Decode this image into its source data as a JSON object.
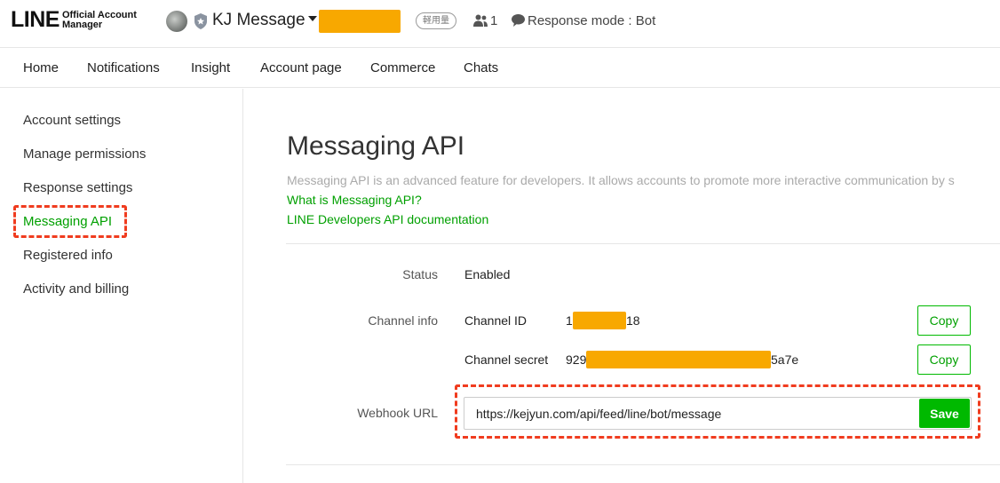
{
  "header": {
    "logo_main": "LINE",
    "logo_sub_line1": "Official Account",
    "logo_sub_line2": "Manager",
    "account_name": "KJ Message",
    "plan_badge": "軽用量",
    "follower_count": "1",
    "response_mode": "Response mode : Bot",
    "icons": [
      "avatar",
      "shield-icon",
      "caret-down-icon",
      "people-icon",
      "chat-bubble-icon"
    ]
  },
  "nav": {
    "items": [
      "Home",
      "Notifications",
      "Insight",
      "Account page",
      "Commerce",
      "Chats"
    ]
  },
  "sidebar": {
    "items": [
      {
        "label": "Account settings"
      },
      {
        "label": "Manage permissions"
      },
      {
        "label": "Response settings"
      },
      {
        "label": "Messaging API",
        "active": true
      },
      {
        "label": "Registered info"
      },
      {
        "label": "Activity and billing"
      }
    ]
  },
  "main": {
    "title": "Messaging API",
    "description": "Messaging API is an advanced feature for developers. It allows accounts to promote more interactive communication by s",
    "links": [
      "What is Messaging API?",
      "LINE Developers API documentation"
    ],
    "status": {
      "label": "Status",
      "value": "Enabled"
    },
    "channel_info": {
      "label": "Channel info",
      "channel_id_label": "Channel ID",
      "channel_id_prefix": "1",
      "channel_id_suffix": "18",
      "channel_secret_label": "Channel secret",
      "channel_secret_prefix": "929",
      "channel_secret_suffix": "5a7e",
      "copy_label": "Copy"
    },
    "webhook": {
      "label": "Webhook URL",
      "value": "https://kejyun.com/api/feed/line/bot/message",
      "save_label": "Save"
    }
  },
  "colors": {
    "accent_green": "#00b900",
    "link_green": "#00a000",
    "redaction": "#f8a800",
    "annotation_red": "#f03c1f"
  }
}
